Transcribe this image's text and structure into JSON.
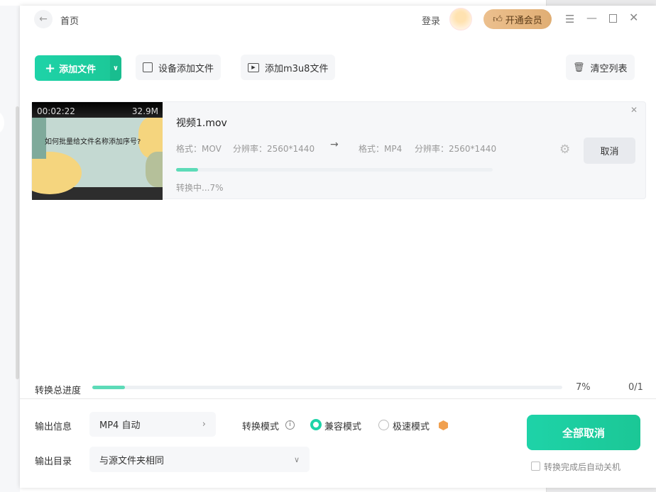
{
  "header": {
    "title": "首页",
    "login": "登录",
    "vip": "开通会员"
  },
  "toolbar": {
    "add_file": "添加文件",
    "device_add": "设备添加文件",
    "add_m3u8": "添加m3u8文件",
    "clear_list": "清空列表"
  },
  "files": [
    {
      "duration": "00:02:22",
      "size": "32.9M",
      "thumb_title": "如何批量给文件名称添加序号?",
      "name": "视频1.mov",
      "src_format": "格式：MOV",
      "src_res": "分辨率：2560*1440",
      "dst_format": "格式：MP4",
      "dst_res": "分辨率：2560*1440",
      "progress": 7,
      "status": "转换中...7%",
      "cancel": "取消"
    }
  ],
  "total": {
    "label": "转换总进度",
    "progress": 7,
    "percent": "7%",
    "count": "0/1"
  },
  "output": {
    "info_label": "输出信息",
    "info_value": "MP4 自动",
    "dir_label": "输出目录",
    "dir_value": "与源文件夹相同",
    "mode_label": "转换模式",
    "mode_compat": "兼容模式",
    "mode_fast": "极速模式",
    "cancel_all": "全部取消",
    "auto_shutdown": "转换完成后自动关机"
  },
  "colors": {
    "accent": "#1ed3a8",
    "vip": "#e3b07a"
  }
}
